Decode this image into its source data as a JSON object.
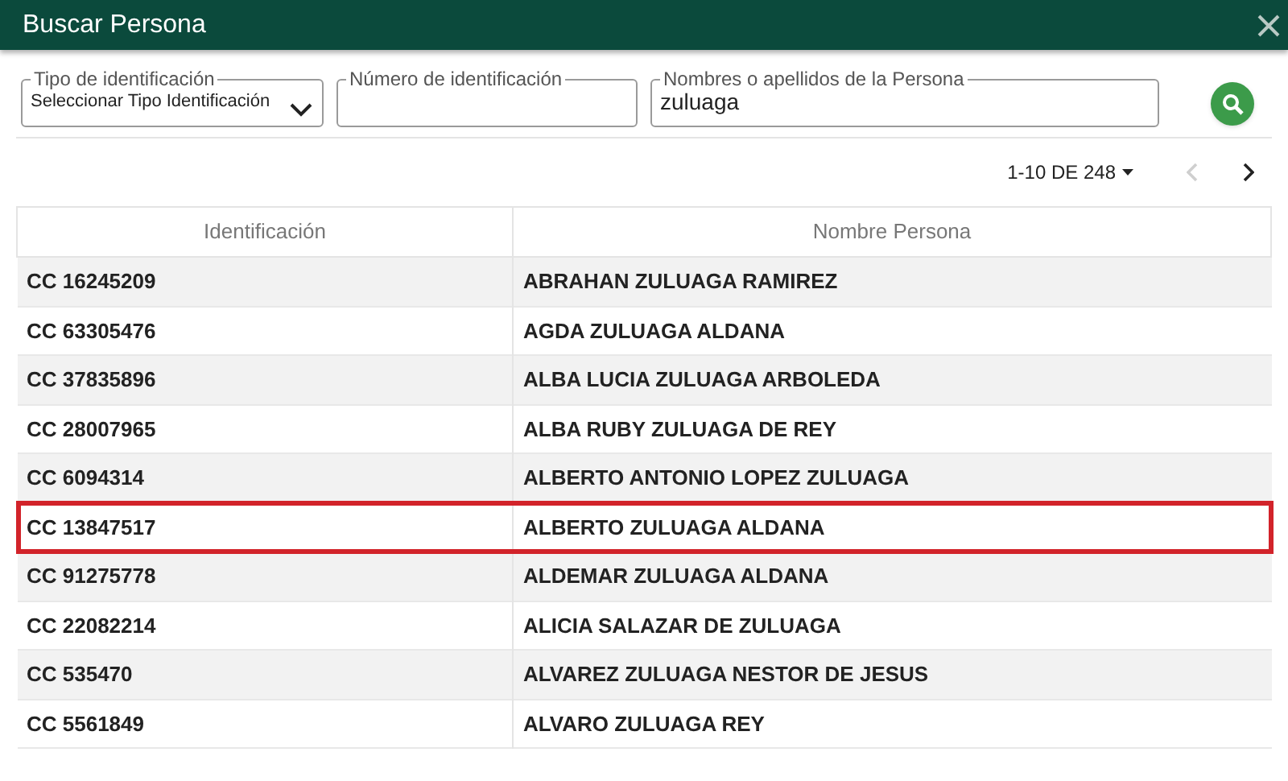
{
  "window": {
    "title": "Buscar Persona"
  },
  "filters": [
    {
      "kind": "select",
      "label": "Tipo de identificación",
      "value": "Seleccionar Tipo Identificación"
    },
    {
      "kind": "text",
      "label": "Número de identificación"
    },
    {
      "kind": "text",
      "label": "Nombres o apellidos de la Persona",
      "value": "zuluaga"
    }
  ],
  "pagination": {
    "range": "1-10 DE 248",
    "prev_disabled": true,
    "next_disabled": false
  },
  "table": {
    "columns": [
      "Identificación",
      "Nombre Persona"
    ],
    "rows": [
      {
        "id": "CC 16245209",
        "name": "ABRAHAN ZULUAGA RAMIREZ",
        "selected": false
      },
      {
        "id": "CC 63305476",
        "name": "AGDA ZULUAGA ALDANA",
        "selected": false
      },
      {
        "id": "CC 37835896",
        "name": "ALBA LUCIA ZULUAGA ARBOLEDA",
        "selected": false
      },
      {
        "id": "CC 28007965",
        "name": "ALBA RUBY ZULUAGA DE REY",
        "selected": false
      },
      {
        "id": "CC 6094314",
        "name": "ALBERTO ANTONIO LOPEZ ZULUAGA",
        "selected": false
      },
      {
        "id": "CC 13847517",
        "name": "ALBERTO ZULUAGA ALDANA",
        "selected": true
      },
      {
        "id": "CC 91275778",
        "name": "ALDEMAR ZULUAGA ALDANA",
        "selected": false
      },
      {
        "id": "CC 22082214",
        "name": "ALICIA SALAZAR DE ZULUAGA",
        "selected": false
      },
      {
        "id": "CC 535470",
        "name": "ALVAREZ ZULUAGA NESTOR DE JESUS",
        "selected": false
      },
      {
        "id": "CC 5561849",
        "name": "ALVARO ZULUAGA REY",
        "selected": false
      }
    ]
  }
}
